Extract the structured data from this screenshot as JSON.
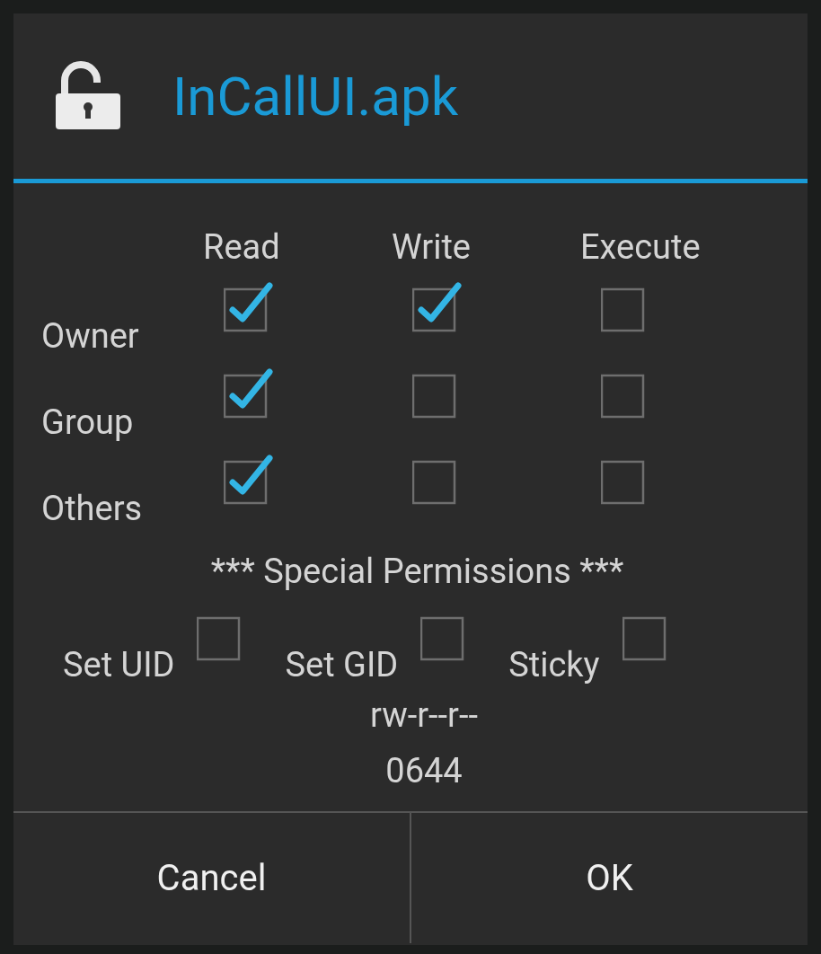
{
  "dialog": {
    "title": "InCallUI.apk",
    "columns": [
      "Read",
      "Write",
      "Execute"
    ],
    "rows": [
      {
        "label": "Owner",
        "permissions": [
          {
            "checked": true
          },
          {
            "checked": true
          },
          {
            "checked": false
          }
        ]
      },
      {
        "label": "Group",
        "permissions": [
          {
            "checked": true
          },
          {
            "checked": false
          },
          {
            "checked": false
          }
        ]
      },
      {
        "label": "Others",
        "permissions": [
          {
            "checked": true
          },
          {
            "checked": false
          },
          {
            "checked": false
          }
        ]
      }
    ],
    "special_heading": "*** Special Permissions ***",
    "special": [
      {
        "label": "Set UID",
        "checked": false
      },
      {
        "label": "Set GID",
        "checked": false
      },
      {
        "label": "Sticky",
        "checked": false
      }
    ],
    "symbolic": "rw-r--r--",
    "octal": "0644",
    "buttons": [
      "Cancel",
      "OK"
    ]
  }
}
